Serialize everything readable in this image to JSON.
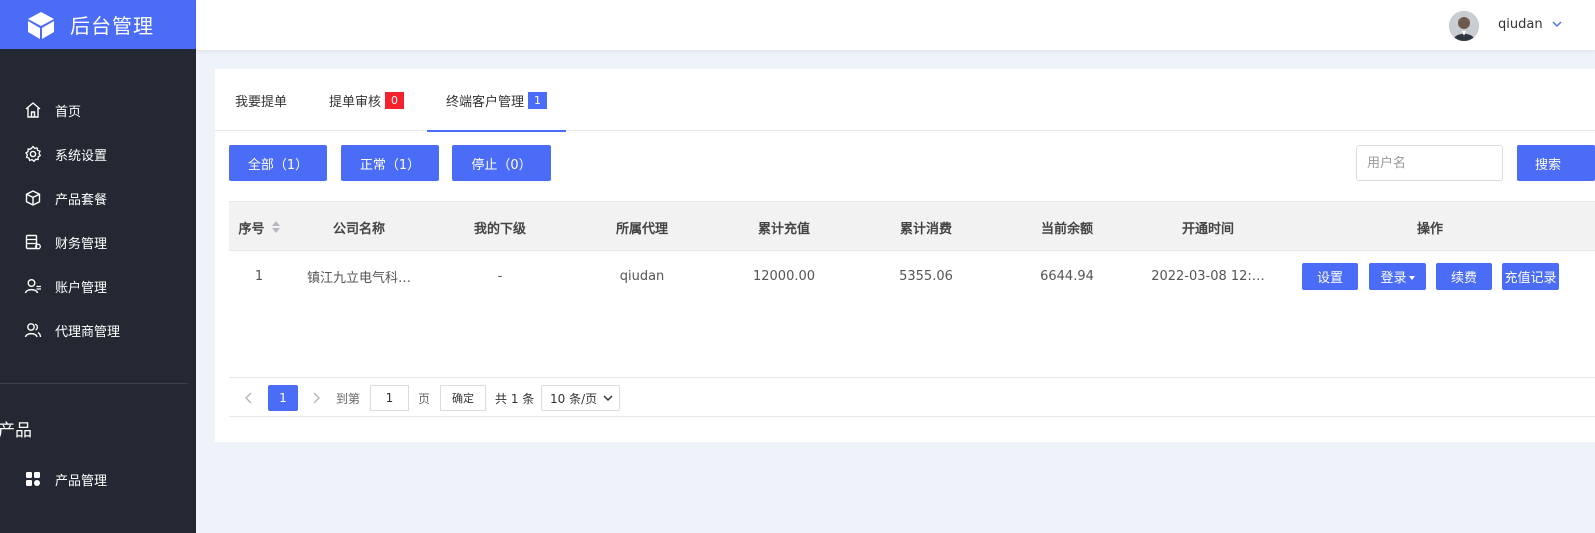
{
  "sidebar": {
    "brand_title": "后台管理",
    "items": [
      {
        "label": "首页",
        "icon": "home-icon"
      },
      {
        "label": "系统设置",
        "icon": "gear-icon"
      },
      {
        "label": "产品套餐",
        "icon": "box-icon"
      },
      {
        "label": "财务管理",
        "icon": "database-icon"
      },
      {
        "label": "账户管理",
        "icon": "user-settings-icon"
      },
      {
        "label": "代理商管理",
        "icon": "users-icon"
      }
    ],
    "section_title": "产品",
    "section_items": [
      {
        "label": "产品管理",
        "icon": "grid-icon"
      }
    ]
  },
  "header": {
    "username": "qiudan"
  },
  "tabs": [
    {
      "label": "我要提单",
      "badge": ""
    },
    {
      "label": "提单审核",
      "badge": "0",
      "badge_color": "#f5222d"
    },
    {
      "label": "终端客户管理",
      "badge": "1",
      "badge_color": "#4a6cf7",
      "active": true
    }
  ],
  "filters": {
    "all": "全部（1）",
    "normal": "正常（1）",
    "stopped": "停止（0）"
  },
  "search": {
    "placeholder": "用户名",
    "value": "",
    "button": "搜索"
  },
  "table": {
    "headers": [
      "序号",
      "公司名称",
      "我的下级",
      "所属代理",
      "累计充值",
      "累计消费",
      "当前余额",
      "开通时间",
      "操作"
    ],
    "rows": [
      {
        "index": "1",
        "company": "镇江九立电气科…",
        "subordinate": "-",
        "agent": "qiudan",
        "total_recharge": "12000.00",
        "total_consume": "5355.06",
        "balance": "6644.94",
        "open_time": "2022-03-08 12:…",
        "actions": {
          "settings": "设置",
          "login": "登录",
          "renew": "续费",
          "recharge_log": "充值记录"
        }
      }
    ]
  },
  "pagination": {
    "current_page": "1",
    "goto_label": "到第",
    "goto_value": "1",
    "page_unit": "页",
    "confirm": "确定",
    "total": "共 1 条",
    "page_size": "10 条/页"
  },
  "colors": {
    "accent": "#4a6cf7",
    "sidebar_bg": "#232833",
    "badge_red": "#f5222d"
  }
}
